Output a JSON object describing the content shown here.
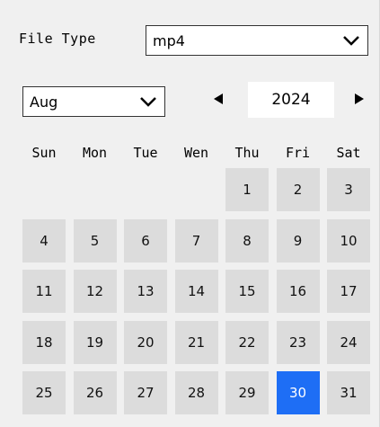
{
  "file_type": {
    "label": "File Type",
    "selected": "mp4"
  },
  "month_select": {
    "selected": "Aug"
  },
  "year": "2024",
  "weekdays": [
    "Sun",
    "Mon",
    "Tue",
    "Wen",
    "Thu",
    "Fri",
    "Sat"
  ],
  "leading_empty_days": 4,
  "days": [
    "1",
    "2",
    "3",
    "4",
    "5",
    "6",
    "7",
    "8",
    "9",
    "10",
    "11",
    "12",
    "13",
    "14",
    "15",
    "16",
    "17",
    "18",
    "19",
    "20",
    "21",
    "22",
    "23",
    "24",
    "25",
    "26",
    "27",
    "28",
    "29",
    "30",
    "31"
  ],
  "selected_day": "30",
  "icons": {
    "dropdown": "chevron-down-icon",
    "prev": "triangle-left-icon",
    "next": "triangle-right-icon"
  },
  "colors": {
    "selected_day_bg": "#1e6ef5",
    "day_bg": "#dcdcdc",
    "panel_bg": "#f0f0f0"
  }
}
